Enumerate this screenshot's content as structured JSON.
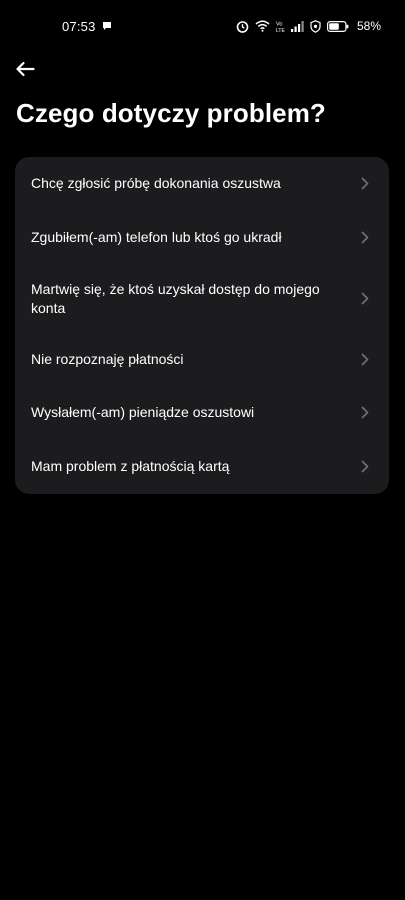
{
  "status_bar": {
    "time": "07:53",
    "battery": "58%",
    "network_label": "Vo LTE"
  },
  "header": {
    "title": "Czego dotyczy problem?"
  },
  "options": [
    {
      "label": "Chcę zgłosić próbę dokonania oszustwa"
    },
    {
      "label": "Zgubiłem(-am) telefon lub ktoś go ukradł"
    },
    {
      "label": "Martwię się, że ktoś uzyskał dostęp do mojego konta"
    },
    {
      "label": "Nie rozpoznaję płatności"
    },
    {
      "label": "Wysłałem(-am) pieniądze oszustowi"
    },
    {
      "label": "Mam problem z płatnością kartą"
    }
  ],
  "colors": {
    "background": "#000000",
    "card": "#1c1c1f",
    "text": "#ffffff",
    "chevron": "#6e6e73"
  },
  "icons": {
    "back": "arrow-left-icon",
    "chevron": "chevron-right-icon",
    "chat": "chat-bubble-icon",
    "alarm": "alarm-icon",
    "wifi": "wifi-icon",
    "volte": "volte-icon",
    "signal": "signal-icon",
    "shield": "shield-icon",
    "battery": "battery-icon"
  }
}
